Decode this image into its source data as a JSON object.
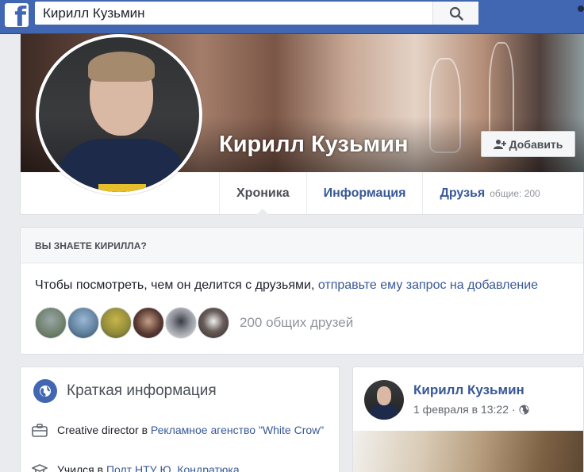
{
  "topbar": {
    "search_value": "Кирилл Кузьмин",
    "logo_letter": "f"
  },
  "profile": {
    "name": "Кирилл Кузьмин",
    "add_friend_label": "Добавить",
    "tabs": [
      {
        "label": "Хроника",
        "active": true
      },
      {
        "label": "Информация",
        "active": false
      },
      {
        "label": "Друзья",
        "sub": "общие: 200",
        "active": false
      }
    ]
  },
  "know_card": {
    "heading": "ВЫ ЗНАЕТЕ КИРИЛЛА?",
    "text_prefix": "Чтобы посмотреть, чем он делится с друзьями, ",
    "text_link": "отправьте ему запрос на добавление",
    "mutual_friends": "200 общих друзей",
    "avatar_colors": [
      "#7a8f9a",
      "#5d7f9c",
      "#8f8a3a",
      "#3b2b2a",
      "#d7d9dc",
      "#6a5e5a"
    ]
  },
  "info_card": {
    "title": "Краткая информация",
    "work_prefix": "Creative director в ",
    "work_link": "Рекламное агенство \"White Crow\"",
    "study_prefix": "Учился в ",
    "study_link": "Полт НТУ Ю. Кондратюка"
  },
  "post": {
    "author": "Кирилл Кузьмин",
    "date": "1 февраля в 13:22",
    "separator": "·"
  },
  "colors": {
    "brand": "#4267b2",
    "link": "#385898",
    "background": "#e9ebee"
  }
}
